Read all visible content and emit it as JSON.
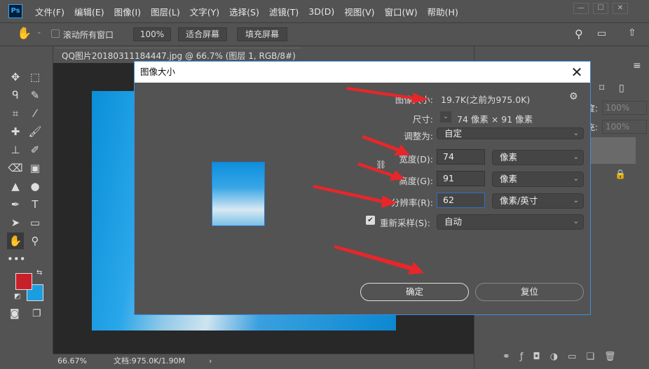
{
  "app": {
    "logo": "Ps"
  },
  "menu": [
    "文件(F)",
    "编辑(E)",
    "图像(I)",
    "图层(L)",
    "文字(Y)",
    "选择(S)",
    "滤镜(T)",
    "3D(D)",
    "视图(V)",
    "窗口(W)",
    "帮助(H)"
  ],
  "options": {
    "scroll_all_label": "滚动所有窗口",
    "zoom_100": "100%",
    "fit_screen": "适合屏幕",
    "fill_screen": "填充屏幕"
  },
  "document": {
    "tab_title": "QQ图片20180311184447.jpg @ 66.7% (图层 1, RGB/8#) *",
    "zoom": "66.67%",
    "doc_info": "文档:975.0K/1.90M"
  },
  "right_panel": {
    "opacity_label": "度:",
    "opacity": "100%",
    "fill_label": "充:",
    "fill": "100%"
  },
  "dialog": {
    "title": "图像大小",
    "image_size_label": "图像大小:",
    "image_size_value": "19.7K(之前为975.0K)",
    "dimensions_label": "尺寸:",
    "dimensions_value": "74 像素 × 91 像素",
    "fit_to_label": "调整为:",
    "fit_to_value": "自定",
    "width_label": "宽度(D):",
    "width_value": "74",
    "width_unit": "像素",
    "height_label": "高度(G):",
    "height_value": "91",
    "height_unit": "像素",
    "resolution_label": "分辨率(R):",
    "resolution_value": "62",
    "resolution_unit": "像素/英寸",
    "resample_label": "重新采样(S):",
    "resample_checked": true,
    "resample_value": "自动",
    "ok_label": "确定",
    "reset_label": "复位"
  },
  "colors": {
    "foreground": "#c8202a",
    "background": "#1a9ee0",
    "annotation_arrows": "#e8262a"
  }
}
